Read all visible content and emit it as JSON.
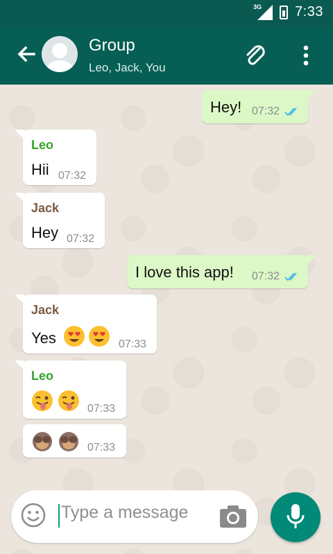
{
  "status_bar": {
    "network": "3G",
    "time": "7:33",
    "colors": {
      "bg": "#0b5a52"
    }
  },
  "header": {
    "title": "Group",
    "subtitle": "Leo, Jack, You",
    "colors": {
      "bg": "#075e54"
    }
  },
  "messages": [
    {
      "direction": "out",
      "sender": "",
      "text": "Hey!",
      "time": "07:32",
      "status": "read"
    },
    {
      "direction": "in",
      "sender": "Leo",
      "text": "Hii",
      "time": "07:32"
    },
    {
      "direction": "in",
      "sender": "Jack",
      "text": "Hey",
      "time": "07:32"
    },
    {
      "direction": "out",
      "sender": "",
      "text": "I love this app!",
      "time": "07:32",
      "status": "read"
    },
    {
      "direction": "in",
      "sender": "Jack",
      "text": "Yes",
      "emojis": [
        "heart-eyes-emoji",
        "heart-eyes-emoji"
      ],
      "time": "07:33"
    },
    {
      "direction": "in",
      "sender": "Leo",
      "emojis": [
        "winking-tongue-emoji",
        "winking-tongue-emoji"
      ],
      "time": "07:33"
    },
    {
      "direction": "in",
      "sender": "",
      "emojis": [
        "see-no-evil-monkey-emoji",
        "see-no-evil-monkey-emoji"
      ],
      "time": "07:33"
    }
  ],
  "composer": {
    "placeholder": "Type a message",
    "icons": [
      "smiley-icon",
      "camera-icon",
      "microphone-icon"
    ],
    "colors": {
      "mic_button": "#008a77"
    }
  },
  "icons": [
    "back-arrow-icon",
    "group-avatar-icon",
    "attachment-clip-icon",
    "more-options-icon",
    "double-check-icon"
  ]
}
